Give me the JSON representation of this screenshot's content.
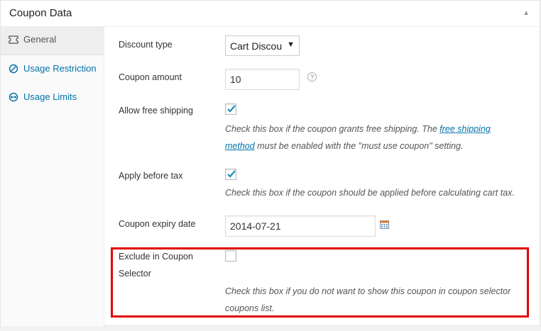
{
  "panel": {
    "title": "Coupon Data",
    "toggle_icon": "triangle-up-icon"
  },
  "sidebar": {
    "tabs": [
      {
        "label": "General",
        "icon": "ticket-icon",
        "active": true
      },
      {
        "label": "Usage Restriction",
        "icon": "no-entry-icon",
        "active": false
      },
      {
        "label": "Usage Limits",
        "icon": "arrows-circle-icon",
        "active": false
      }
    ]
  },
  "fields": {
    "discount_type": {
      "label": "Discount type",
      "value": "Cart Discou"
    },
    "coupon_amount": {
      "label": "Coupon amount",
      "value": "10"
    },
    "free_shipping": {
      "label": "Allow free shipping",
      "checked": true,
      "desc_before": "Check this box if the coupon grants free shipping. The ",
      "desc_link_1": "free shipping",
      "desc_link_2": "method",
      "desc_after": " must be enabled with the \"must use coupon\" setting."
    },
    "before_tax": {
      "label": "Apply before tax",
      "checked": true,
      "desc": "Check this box if the coupon should be applied before calculating cart tax."
    },
    "expiry": {
      "label": "Coupon expiry date",
      "value": "2014-07-21"
    },
    "exclude": {
      "label_line1": "Exclude in Coupon",
      "label_line2": "Selector",
      "checked": false,
      "desc_line1": "Check this box if you do not want to show this coupon in coupon selector",
      "desc_line2": "coupons list."
    }
  },
  "colors": {
    "link": "#0073aa",
    "highlight": "#e00000",
    "check": "#1e8cbe"
  }
}
